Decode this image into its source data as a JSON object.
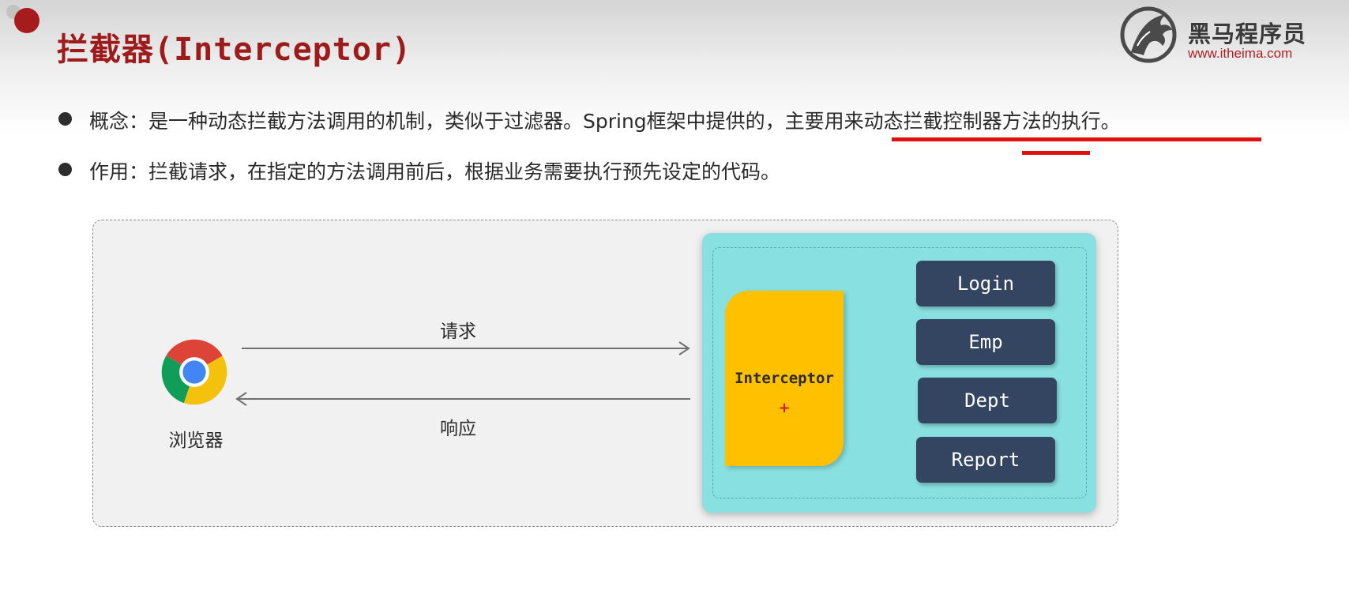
{
  "title": "拦截器(Interceptor)",
  "logo": {
    "name": "黑马程序员",
    "url": "www.itheima.com"
  },
  "bullets": [
    {
      "text": "概念：是一种动态拦截方法调用的机制，类似于过滤器。Spring框架中提供的，主要用来动态拦截控制器方法的执行。"
    },
    {
      "text": "作用：拦截请求，在指定的方法调用前后，根据业务需要执行预先设定的代码。"
    }
  ],
  "diagram": {
    "browser_label": "浏览器",
    "request_label": "请求",
    "response_label": "响应",
    "interceptor_label": "Interceptor",
    "interceptor_mark": "+",
    "controllers": [
      "Login",
      "Emp",
      "Dept",
      "Report"
    ]
  },
  "colors": {
    "title": "#9e1b1b",
    "underline": "#e01010",
    "server_bg": "#89e0e0",
    "interceptor_bg": "#ffc000",
    "controller_bg": "#334560"
  }
}
